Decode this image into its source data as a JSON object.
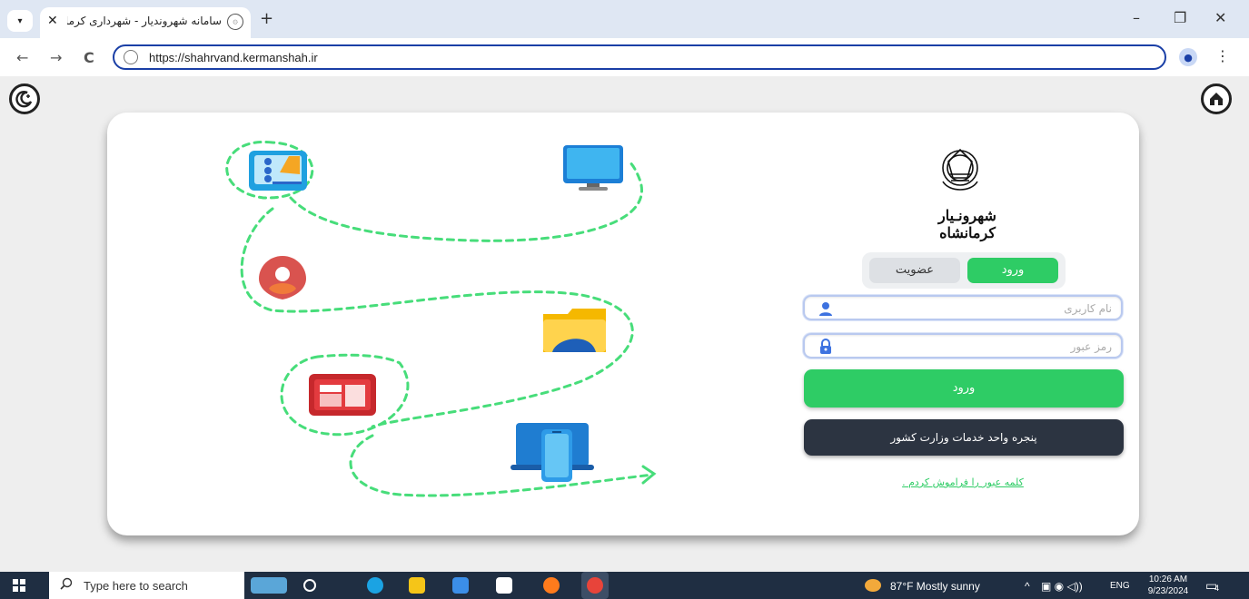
{
  "browser": {
    "tab_title": "سامانه شهروندیار - شهرداری کرمانشاه",
    "tab_close": "✕",
    "new_tab": "+",
    "url": "https://shahrvand.kermanshah.ir",
    "minimize": "–",
    "restore": "❐",
    "close": "✕",
    "back": "←",
    "forward": "→",
    "reload": "C",
    "menu": "⋮"
  },
  "login": {
    "brand_text": "شهرونـیار کرمانشاه",
    "tab_login": "ورود",
    "tab_signup": "عضویت",
    "username_placeholder": "نام کاربری",
    "password_placeholder": "رمز عبور",
    "submit": "ورود",
    "ministry_button": "پنجره واحد خدمات وزارت کشور",
    "forgot": "کلمه عبور را فراموش کردم ."
  },
  "icons": {
    "theme_toggle": "moon-plus-icon",
    "home": "home-icon"
  },
  "taskbar": {
    "search_placeholder": "Type here to search",
    "weather": "87°F  Mostly sunny",
    "language": "ENG",
    "time": "10:26 AM",
    "date": "9/23/2024",
    "notifications": "4"
  },
  "colors": {
    "accent_green": "#2ecc65",
    "dark_button": "#2c3441",
    "dash_path": "#47dd7a"
  }
}
